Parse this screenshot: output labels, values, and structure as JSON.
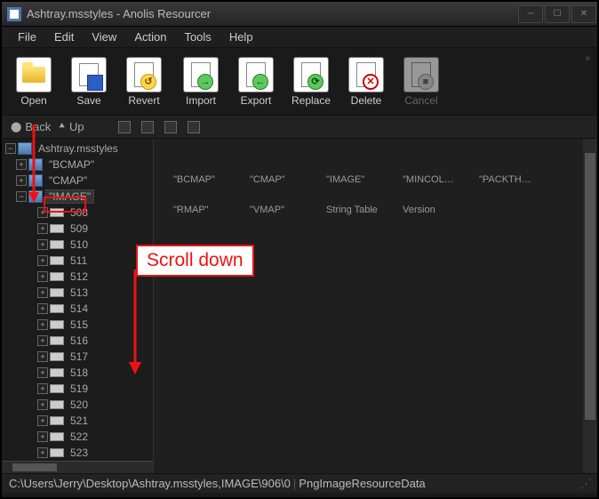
{
  "titlebar": {
    "title": "Ashtray.msstyles - Anolis Resourcer"
  },
  "menu": [
    "File",
    "Edit",
    "View",
    "Action",
    "Tools",
    "Help"
  ],
  "toolbar": {
    "open": "Open",
    "save": "Save",
    "revert": "Revert",
    "import": "Import",
    "export": "Export",
    "replace": "Replace",
    "delete": "Delete",
    "cancel": "Cancel"
  },
  "nav": {
    "back": "Back",
    "up": "Up"
  },
  "tree": {
    "root": "Ashtray.msstyles",
    "groups": [
      "\"BCMAP\"",
      "\"CMAP\"",
      "\"IMAGE\""
    ],
    "images": [
      "508",
      "509",
      "510",
      "511",
      "512",
      "513",
      "514",
      "515",
      "516",
      "517",
      "518",
      "519",
      "520",
      "521",
      "522",
      "523"
    ]
  },
  "grid": {
    "row1": [
      "\"BCMAP\"",
      "\"CMAP\"",
      "\"IMAGE\"",
      "\"MINCOLO...",
      "\"PACKTHE...",
      "\"RMAP\""
    ],
    "row2": [
      "\"VMAP\"",
      "String Table",
      "Version"
    ]
  },
  "status": {
    "path": "C:\\Users\\Jerry\\Desktop\\Ashtray.msstyles,IMAGE\\906\\0",
    "type": "PngImageResourceData"
  },
  "annotation": {
    "label": "Scroll down"
  }
}
